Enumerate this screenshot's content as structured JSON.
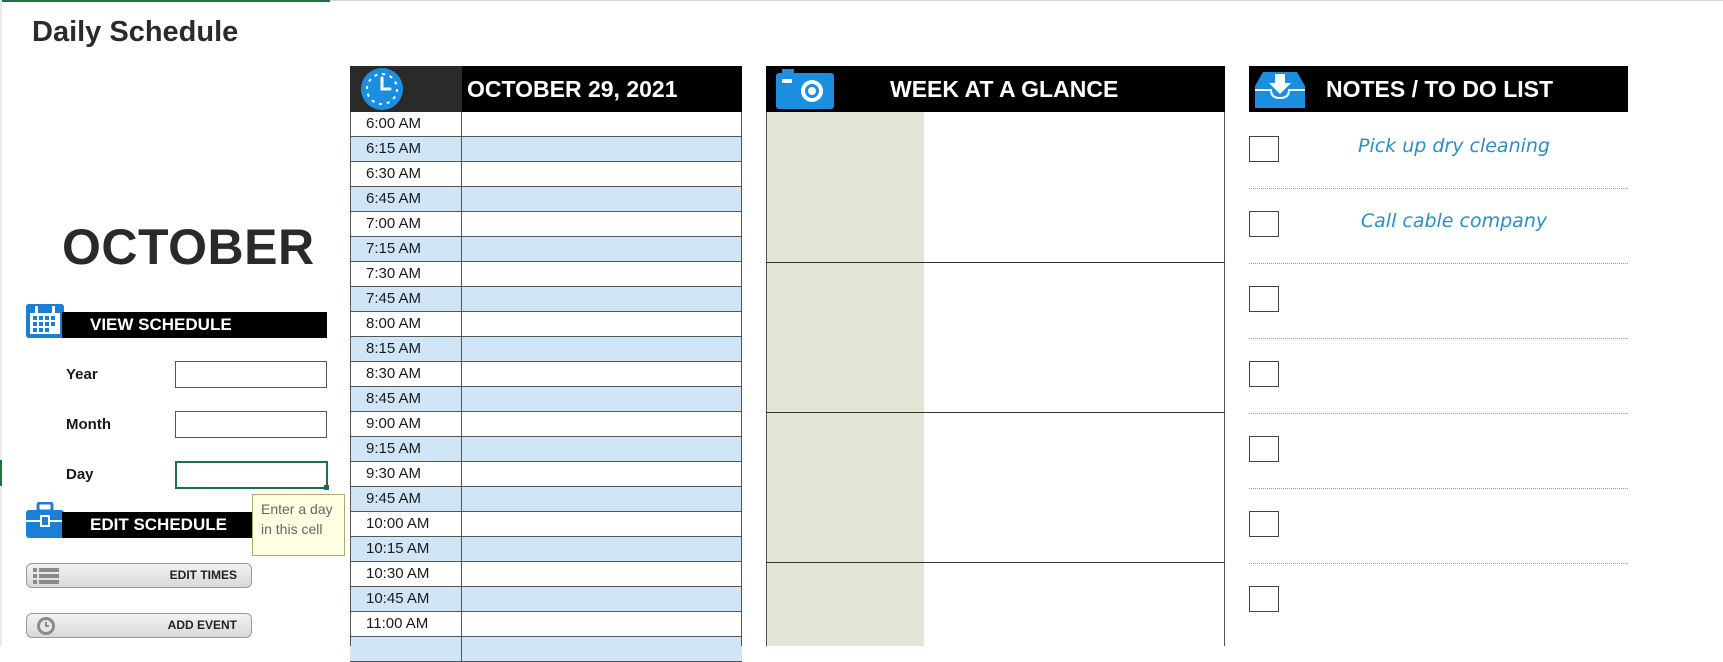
{
  "page": {
    "title": "Daily Schedule",
    "month": "OCTOBER"
  },
  "view_schedule": {
    "label": "VIEW SCHEDULE",
    "fields": [
      {
        "label": "Year",
        "value": ""
      },
      {
        "label": "Month",
        "value": ""
      },
      {
        "label": "Day",
        "value": ""
      }
    ],
    "tooltip": "Enter a day in this cell"
  },
  "edit_schedule": {
    "label": "EDIT SCHEDULE",
    "buttons": {
      "edit_times": "EDIT TIMES",
      "add_event": "ADD EVENT"
    }
  },
  "schedule": {
    "date": "OCTOBER 29, 2021",
    "times": [
      "6:00 AM",
      "6:15 AM",
      "6:30 AM",
      "6:45 AM",
      "7:00 AM",
      "7:15 AM",
      "7:30 AM",
      "7:45 AM",
      "8:00 AM",
      "8:15 AM",
      "8:30 AM",
      "8:45 AM",
      "9:00 AM",
      "9:15 AM",
      "9:30 AM",
      "9:45 AM",
      "10:00 AM",
      "10:15 AM",
      "10:30 AM",
      "10:45 AM",
      "11:00 AM",
      ""
    ]
  },
  "week": {
    "title": "WEEK AT A GLANCE"
  },
  "notes": {
    "title": "NOTES / TO DO LIST",
    "items": [
      "Pick up dry cleaning",
      "Call cable company",
      "",
      "",
      "",
      "",
      ""
    ]
  },
  "colors": {
    "accent_blue": "#1c7fd6",
    "row_alt": "#d0e6f7",
    "week_col": "#e4e4d5",
    "note_text": "#2a8fc2",
    "header": "#000000"
  },
  "icons": [
    "clock-icon",
    "camera-icon",
    "inbox-download-icon",
    "calendar-icon",
    "toolbox-icon",
    "list-icon",
    "clock-outline-icon"
  ]
}
